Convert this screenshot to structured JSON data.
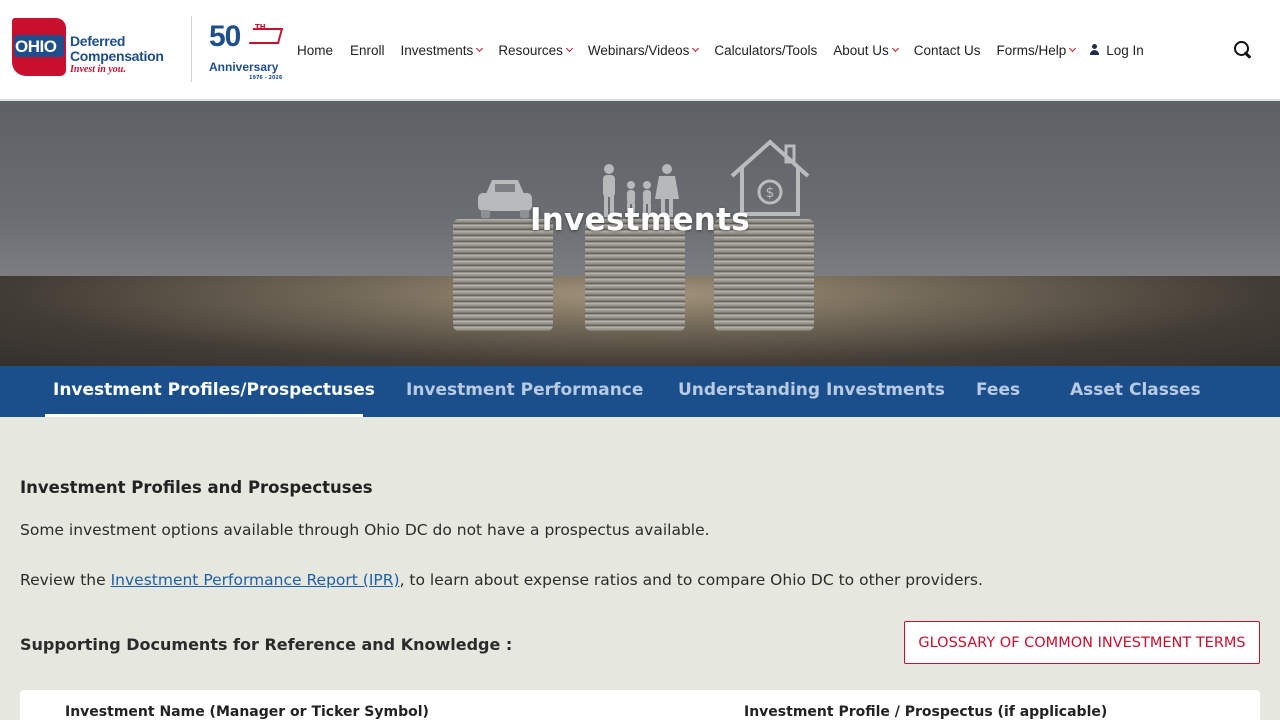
{
  "brand": {
    "ohio": "OHIO",
    "line1": "Deferred",
    "line2": "Compensation",
    "tagline": "Invest in you.",
    "anniversary_number": "50",
    "anniversary_suffix": "TH",
    "anniversary_word": "Anniversary",
    "anniversary_years": "1976 - 2026",
    "primary_color": "#1f4e8c",
    "accent_color": "#c8102e"
  },
  "nav": {
    "items": [
      {
        "label": "Home",
        "dropdown": false
      },
      {
        "label": "Enroll",
        "dropdown": false
      },
      {
        "label": "Investments",
        "dropdown": true
      },
      {
        "label": "Resources",
        "dropdown": true
      },
      {
        "label": "Webinars/Videos",
        "dropdown": true
      },
      {
        "label": "Calculators/Tools",
        "dropdown": false
      },
      {
        "label": "About Us",
        "dropdown": true
      },
      {
        "label": "Contact Us",
        "dropdown": false
      },
      {
        "label": "Forms/Help",
        "dropdown": true
      }
    ],
    "login": "Log In",
    "search_icon": "search-icon"
  },
  "hero": {
    "title": "Investments"
  },
  "tabs": {
    "items": [
      {
        "label": "Investment Profiles/Prospectuses",
        "active": true
      },
      {
        "label": "Investment Performance",
        "active": false
      },
      {
        "label": "Understanding Investments",
        "active": false
      },
      {
        "label": "Fees",
        "active": false
      },
      {
        "label": "Asset Classes",
        "active": false
      }
    ],
    "bar_color": "#1b4f8c"
  },
  "content": {
    "heading": "Investment Profiles and Prospectuses",
    "para1": "Some investment options available through Ohio DC do not have a prospectus available.",
    "para2_before": "Review the ",
    "para2_link": "Investment Performance Report (IPR)",
    "para2_after": ", to learn about expense ratios and to compare Ohio DC to other providers.",
    "supporting_heading": "Supporting Documents for Reference and Knowledge :",
    "glossary_button": "GLOSSARY OF COMMON INVESTMENT TERMS"
  },
  "table": {
    "columns": [
      "Investment Name (Manager or Ticker Symbol)",
      "Investment Profile / Prospectus (if applicable)"
    ]
  }
}
